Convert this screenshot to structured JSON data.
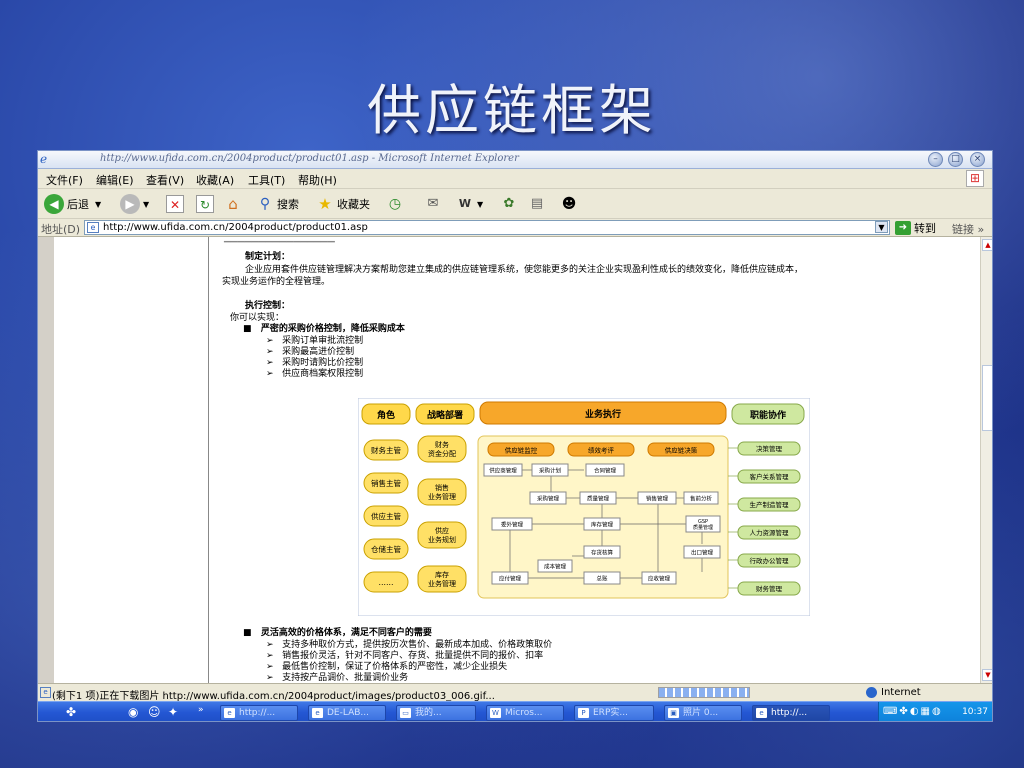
{
  "slide": {
    "title": "供应链框架"
  },
  "browser": {
    "window_title": "http://www.ufida.com.cn/2004product/product01.asp - Microsoft Internet Explorer",
    "menu": [
      "文件(F)",
      "编辑(E)",
      "查看(V)",
      "收藏(A)",
      "工具(T)",
      "帮助(H)"
    ],
    "toolbar": {
      "back": "后退",
      "search": "搜索",
      "favorites": "收藏夹"
    },
    "address_label": "地址(D)",
    "address_value": "http://www.ufida.com.cn/2004product/product01.asp",
    "go": "转到",
    "links": "链接"
  },
  "page": {
    "plan_title": "制定计划：",
    "plan_line1": "企业应用套件供应链管理解决方案帮助您建立集成的供应链管理系统，使您能更多的关注企业实现盈利性成长的绩效变化，降低供应链成本，",
    "plan_line2": "实现业务运作的全程管理。",
    "exec_title": "执行控制：",
    "exec_intro": "你可以实现：",
    "section1": {
      "title": "严密的采购价格控制，降低采购成本",
      "items": [
        "采购订单审批流控制",
        "采购最高进价控制",
        "采购时请购比价控制",
        "供应商档案权限控制"
      ]
    },
    "section2": {
      "title": "灵活高效的价格体系，满足不同客户的需要",
      "items": [
        "支持多种取价方式，提供按历次售价、最新成本加成、价格政策取价",
        "销售报价灵活，针对不同客户、存货、批量提供不同的报价、扣率",
        "最低售价控制，保证了价格体系的严密性，减少企业损失",
        "支持按产品调价、批量调价业务"
      ]
    }
  },
  "diagram": {
    "headers": {
      "role": "角色",
      "strategy": "战略部署",
      "business": "业务执行",
      "function": "职能协作"
    },
    "roles": [
      "财务主管",
      "销售主管",
      "供应主管",
      "仓储主管",
      "……"
    ],
    "strategy": [
      "财务\n资金分配",
      "销售\n业务管理",
      "供应\n业务规划",
      "库存\n业务管理"
    ],
    "top_pills": [
      "供应链监控",
      "绩效考评",
      "供应链决策"
    ],
    "nodes": [
      "供应商管理",
      "采购计划",
      "合同管理",
      "采购管理",
      "质量管理",
      "销售管理",
      "售前分析",
      "委外管理",
      "库存管理",
      "GSP\n质量管理",
      "存货核算",
      "成本管理",
      "出口管理",
      "应付管理",
      "总账",
      "应收管理"
    ],
    "functions": [
      "决策管理",
      "客户关系管理",
      "生产制造管理",
      "人力资源管理",
      "行政办公管理",
      "财务管理"
    ]
  },
  "status": {
    "text": "(剩下1 项)正在下载图片 http://www.ufida.com.cn/2004product/images/product03_006.gif...",
    "zone": "Internet",
    "progress": 1.0
  },
  "taskbar": {
    "buttons": [
      "http://...",
      "DE-LAB...",
      "我的...",
      "Micros...",
      "ERP实...",
      "照片 0...",
      "http://..."
    ],
    "clock": "10:37"
  },
  "colors": {
    "pill_orange": "#f5a623",
    "role_yellow": "#ffe066",
    "func_green": "#cfe8a0"
  }
}
